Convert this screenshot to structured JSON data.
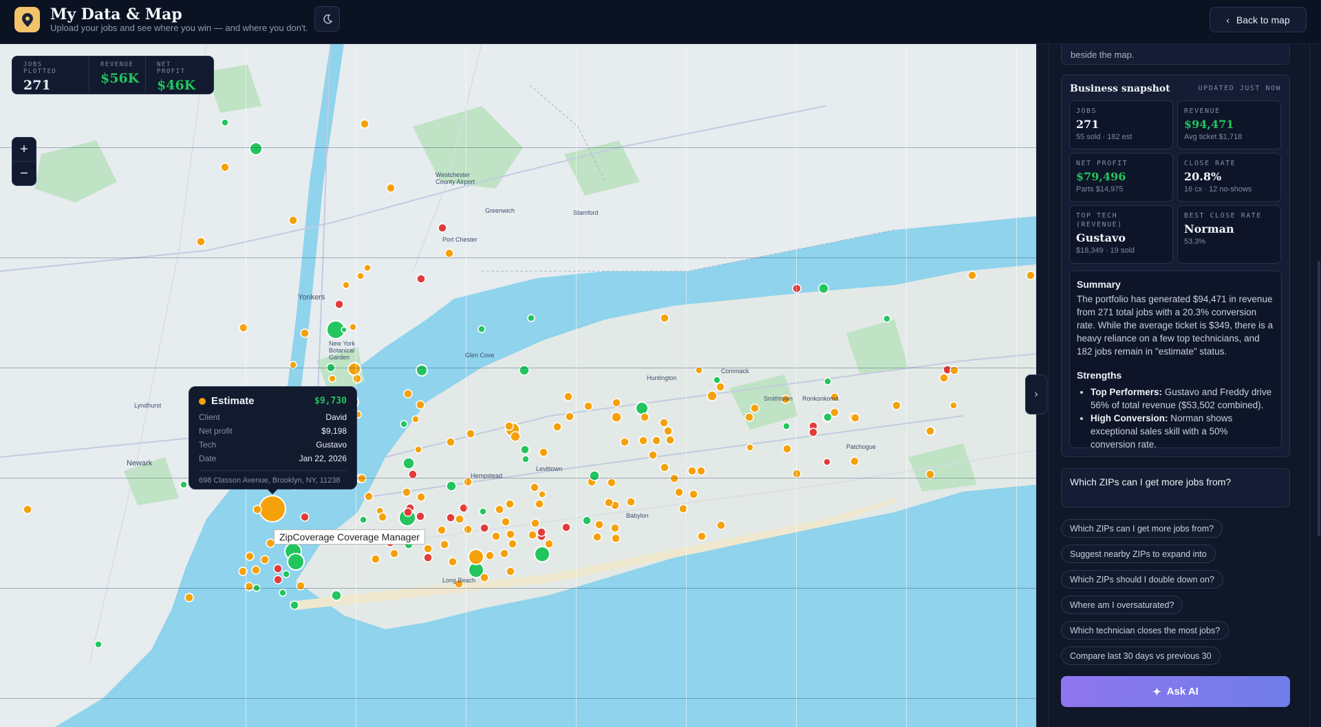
{
  "header": {
    "title": "My Data & Map",
    "subtitle": "Upload your jobs and see where you win — and where you don't.",
    "back_label": "Back to map"
  },
  "map": {
    "stats": [
      {
        "label": "JOBS PLOTTED",
        "value": "271"
      },
      {
        "label": "REVENUE",
        "value": "$56K"
      },
      {
        "label": "NET PROFIT",
        "value": "$46K"
      }
    ],
    "zoom_in": "+",
    "zoom_out": "−",
    "tooltip": {
      "status": "Estimate",
      "amount": "$9,730",
      "rows": [
        {
          "key": "Client",
          "value": "David"
        },
        {
          "key": "Net profit",
          "value": "$9,198"
        },
        {
          "key": "Tech",
          "value": "Gustavo"
        },
        {
          "key": "Date",
          "value": "Jan 22, 2026"
        }
      ],
      "address": "698 Classon Avenue, Brooklyn, NY, 11238"
    },
    "hover_label": "ZipCoverage Coverage Manager",
    "place_labels": [
      "Yonkers",
      "Newark",
      "New York Botanical Garden",
      "Westchester County Airport",
      "Port Chester",
      "Glen Cove",
      "Huntington",
      "Commack",
      "Smithtown",
      "Ronkonkoma",
      "Patchogue",
      "Hempstead",
      "Long Beach",
      "Babylon",
      "Greenwich",
      "Stamford",
      "Levittown",
      "Lyndhurst"
    ],
    "colors": {
      "sold": "#22c55e",
      "estimate": "#f5a10b",
      "no_show": "#e23b3b"
    }
  },
  "panel": {
    "prev_text": "beside the map.",
    "snapshot_title": "Business snapshot",
    "updated": "UPDATED JUST NOW",
    "kpis": [
      {
        "label": "JOBS",
        "value": "271",
        "sub": "55 sold · 182 est"
      },
      {
        "label": "REVENUE",
        "value": "$94,471",
        "sub": "Avg ticket $1,718"
      },
      {
        "label": "NET PROFIT",
        "value": "$79,496",
        "sub": "Parts $14,975"
      },
      {
        "label": "CLOSE RATE",
        "value": "20.8%",
        "sub": "16 cx · 12 no-shows"
      },
      {
        "label": "TOP TECH (REVENUE)",
        "value": "Gustavo",
        "sub": "$18,349 · 19 sold"
      },
      {
        "label": "BEST CLOSE RATE",
        "value": "Norman",
        "sub": "53.3%"
      }
    ],
    "summary": {
      "heading": "Summary",
      "text": "The portfolio has generated $94,471 in revenue from 271 total jobs with a 20.3% conversion rate. While the average ticket is $349, there is a heavy reliance on a few top technicians, and 182 jobs remain in \"estimate\" status.",
      "strengths_heading": "Strengths",
      "strengths": [
        {
          "bold": "Top Performers:",
          "text": " Gustavo and Freddy drive 56% of total revenue ($53,502 combined)."
        },
        {
          "bold": "High Conversion:",
          "text": " Norman shows exceptional sales skill with a 50% conversion rate."
        }
      ]
    },
    "question": "Which ZIPs can I get more jobs from?",
    "suggestions": [
      "Which ZIPs can I get more jobs from?",
      "Suggest nearby ZIPs to expand into",
      "Which ZIPs should I double down on?",
      "Where am I oversaturated?",
      "Which technician closes the most jobs?",
      "Compare last 30 days vs previous 30"
    ],
    "ask_label": "Ask AI"
  }
}
